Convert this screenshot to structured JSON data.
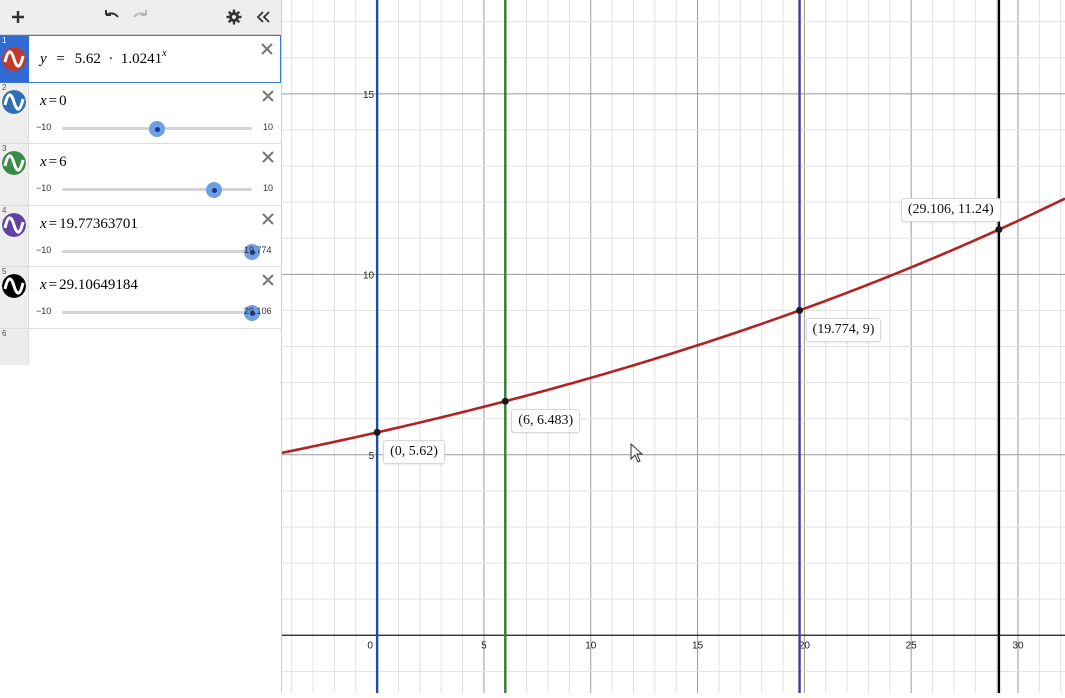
{
  "toolbar": {
    "add_icon": "plus-icon",
    "undo_icon": "undo-icon",
    "redo_icon": "redo-icon",
    "settings_icon": "gear-icon",
    "collapse_icon": "double-chevron-left-icon"
  },
  "expressions": [
    {
      "num": "1",
      "color": "#c0392b",
      "var": "y",
      "equals": "=",
      "lhs_text": "5.62  ·  1.0241",
      "exponent": "x",
      "active": true
    },
    {
      "num": "2",
      "color": "#2d70b3",
      "var": "x",
      "equals": "=",
      "value": "0",
      "slider": {
        "min": "−10",
        "max": "10",
        "fraction": 0.5
      }
    },
    {
      "num": "3",
      "color": "#388c46",
      "var": "x",
      "equals": "=",
      "value": "6",
      "slider": {
        "min": "−10",
        "max": "10",
        "fraction": 0.8
      }
    },
    {
      "num": "4",
      "color": "#6042a6",
      "var": "x",
      "equals": "=",
      "value": "19.77363701",
      "slider": {
        "min": "−10",
        "max": "19.774",
        "fraction": 1.0
      }
    },
    {
      "num": "5",
      "color": "#000000",
      "var": "x",
      "equals": "=",
      "value": "29.10649184",
      "slider": {
        "min": "−10",
        "max": "29.106",
        "fraction": 1.0
      }
    },
    {
      "num": "6"
    }
  ],
  "graph": {
    "x_range": [
      -4.5,
      32.2
    ],
    "y_range": [
      -1.6,
      17.6
    ],
    "x_ticks": [
      "0",
      "5",
      "10",
      "15",
      "20",
      "25",
      "30"
    ],
    "y_ticks": [
      "5",
      "10",
      "15"
    ],
    "curve": {
      "a": 5.62,
      "b": 1.0241,
      "color": "#b22222"
    },
    "vertical_lines": [
      {
        "x": 0,
        "color": "#1f4e9c"
      },
      {
        "x": 6,
        "color": "#2e7d32"
      },
      {
        "x": 19.774,
        "color": "#4b3a9c"
      },
      {
        "x": 29.106,
        "color": "#000000"
      }
    ],
    "points": [
      {
        "x": 0,
        "y": 5.62,
        "label": "(0, 5.62)",
        "placement": "below-right"
      },
      {
        "x": 6,
        "y": 6.483,
        "label": "(6, 6.483)",
        "placement": "below-right"
      },
      {
        "x": 19.774,
        "y": 9,
        "label": "(19.774, 9)",
        "placement": "below-right"
      },
      {
        "x": 29.106,
        "y": 11.24,
        "label": "(29.106, 11.24)",
        "placement": "above-left"
      }
    ]
  }
}
